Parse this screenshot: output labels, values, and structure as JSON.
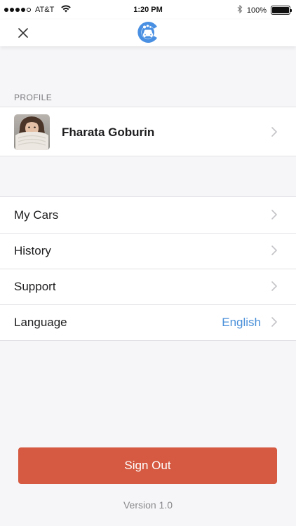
{
  "status_bar": {
    "carrier": "AT&T",
    "time": "1:20 PM",
    "battery_percent": "100%",
    "battery_level": 1.0,
    "signal_bars_filled": 4,
    "signal_bars_total": 5
  },
  "nav": {
    "close_icon": "close-icon",
    "logo_icon": "app-logo-car-wash"
  },
  "profile": {
    "section_header": "PROFILE",
    "name": "Fharata Goburin"
  },
  "menu": {
    "items": [
      {
        "label": "My Cars"
      },
      {
        "label": "History"
      },
      {
        "label": "Support"
      },
      {
        "label": "Language",
        "value": "English"
      }
    ]
  },
  "footer": {
    "sign_out_label": "Sign Out",
    "version": "Version 1.0"
  },
  "colors": {
    "accent_blue": "#4a90d9",
    "sign_out_red": "#d55a41",
    "background": "#f6f6f8"
  }
}
